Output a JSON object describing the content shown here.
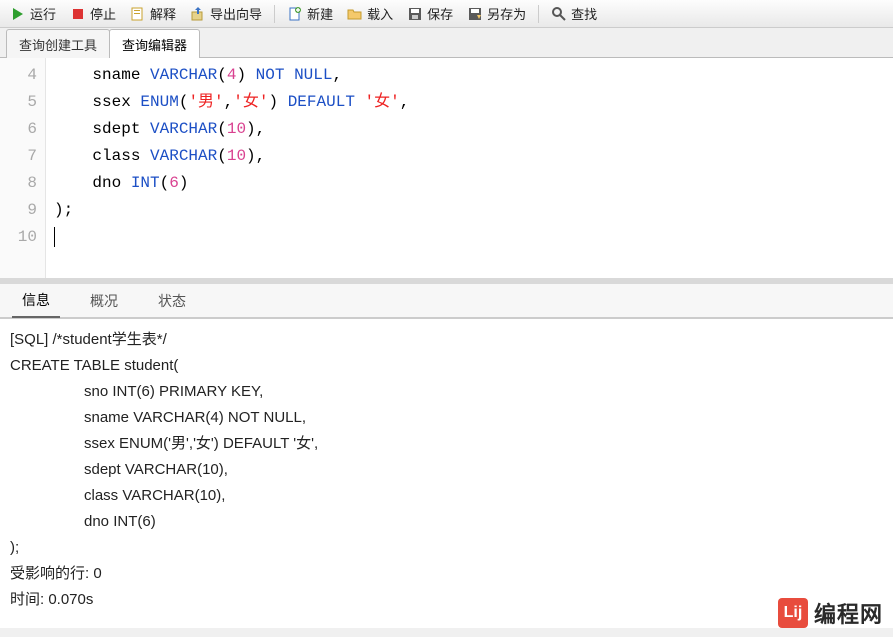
{
  "toolbar": {
    "run": "运行",
    "stop": "停止",
    "explain": "解释",
    "export_wizard": "导出向导",
    "new": "新建",
    "load": "载入",
    "save": "保存",
    "save_as": "另存为",
    "find": "查找"
  },
  "tabs": {
    "query_builder": "查询创建工具",
    "query_editor": "查询编辑器"
  },
  "editor": {
    "line_numbers": [
      "4",
      "5",
      "6",
      "7",
      "8",
      "9",
      "10"
    ],
    "lines": [
      {
        "indent": "    ",
        "tokens": [
          {
            "t": "id",
            "v": "sname "
          },
          {
            "t": "type",
            "v": "VARCHAR"
          },
          {
            "t": "paren",
            "v": "("
          },
          {
            "t": "num",
            "v": "4"
          },
          {
            "t": "paren",
            "v": ")"
          },
          {
            "t": "id",
            "v": " "
          },
          {
            "t": "kw",
            "v": "NOT NULL"
          },
          {
            "t": "paren",
            "v": ","
          }
        ]
      },
      {
        "indent": "    ",
        "tokens": [
          {
            "t": "id",
            "v": "ssex "
          },
          {
            "t": "type",
            "v": "ENUM"
          },
          {
            "t": "paren",
            "v": "("
          },
          {
            "t": "str",
            "v": "'男'"
          },
          {
            "t": "paren",
            "v": ","
          },
          {
            "t": "str",
            "v": "'女'"
          },
          {
            "t": "paren",
            "v": ")"
          },
          {
            "t": "id",
            "v": " "
          },
          {
            "t": "kw",
            "v": "DEFAULT"
          },
          {
            "t": "id",
            "v": " "
          },
          {
            "t": "str",
            "v": "'女'"
          },
          {
            "t": "paren",
            "v": ","
          }
        ]
      },
      {
        "indent": "    ",
        "tokens": [
          {
            "t": "id",
            "v": "sdept "
          },
          {
            "t": "type",
            "v": "VARCHAR"
          },
          {
            "t": "paren",
            "v": "("
          },
          {
            "t": "num",
            "v": "10"
          },
          {
            "t": "paren",
            "v": ")"
          },
          {
            "t": "paren",
            "v": ","
          }
        ]
      },
      {
        "indent": "    ",
        "tokens": [
          {
            "t": "id",
            "v": "class "
          },
          {
            "t": "type",
            "v": "VARCHAR"
          },
          {
            "t": "paren",
            "v": "("
          },
          {
            "t": "num",
            "v": "10"
          },
          {
            "t": "paren",
            "v": ")"
          },
          {
            "t": "paren",
            "v": ","
          }
        ]
      },
      {
        "indent": "    ",
        "tokens": [
          {
            "t": "id",
            "v": "dno "
          },
          {
            "t": "type",
            "v": "INT"
          },
          {
            "t": "paren",
            "v": "("
          },
          {
            "t": "num",
            "v": "6"
          },
          {
            "t": "paren",
            "v": ")"
          }
        ]
      },
      {
        "indent": "",
        "tokens": [
          {
            "t": "paren",
            "v": ");"
          }
        ]
      },
      {
        "indent": "",
        "tokens": []
      }
    ]
  },
  "bottom_tabs": {
    "info": "信息",
    "profile": "概况",
    "status": "状态"
  },
  "output": {
    "line1": "[SQL] /*student学生表*/",
    "line2": "CREATE TABLE student(",
    "cols": [
      "sno INT(6) PRIMARY KEY,",
      "sname VARCHAR(4) NOT NULL,",
      "ssex ENUM('男','女') DEFAULT '女',",
      "sdept VARCHAR(10),",
      "class VARCHAR(10),",
      "dno INT(6)"
    ],
    "close": ");",
    "affected": "受影响的行: 0",
    "time": "时间: 0.070s"
  },
  "watermark": {
    "badge": "Lij",
    "text": "编程网"
  },
  "colors": {
    "keyword": "#1c4fc5",
    "number": "#d94190",
    "string": "#e22"
  }
}
